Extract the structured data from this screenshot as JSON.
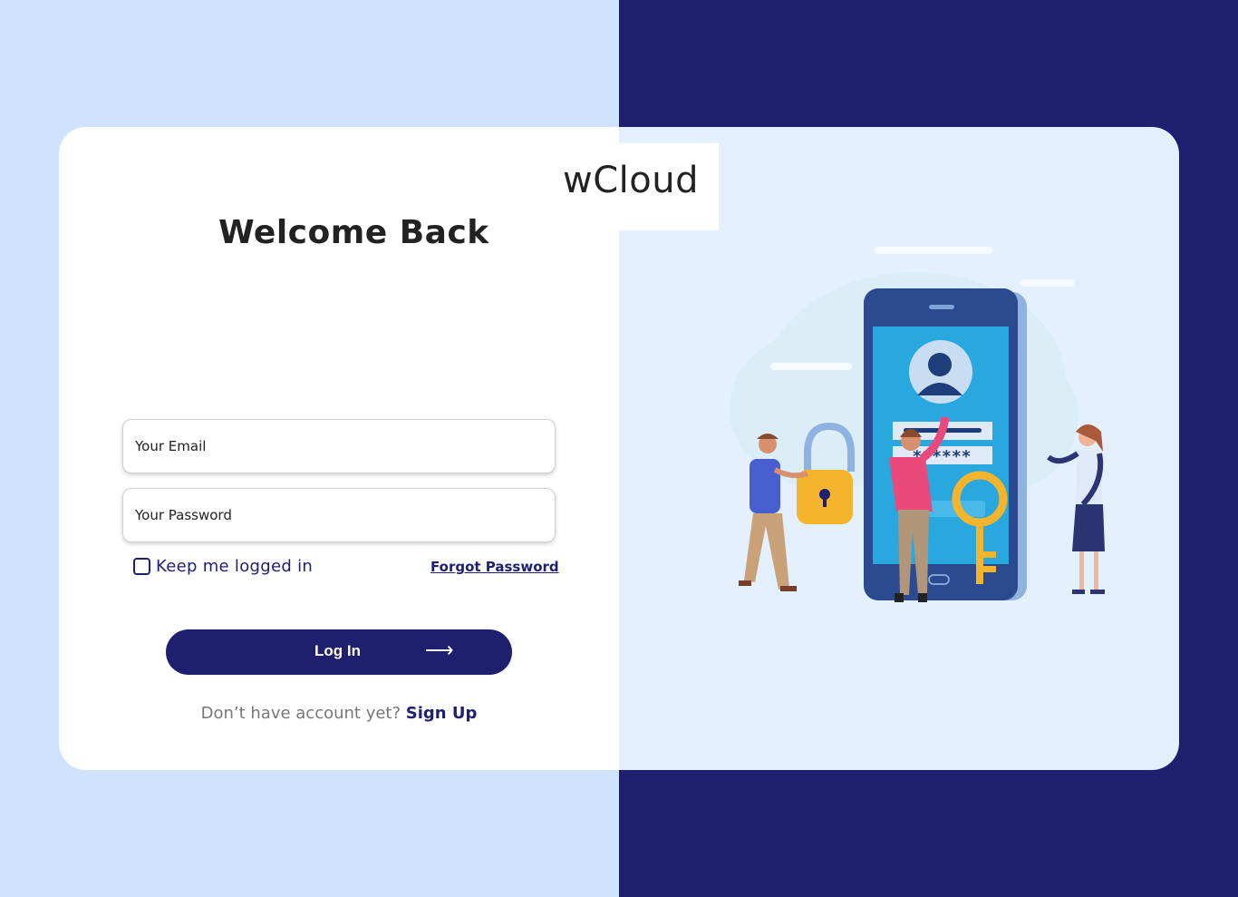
{
  "brand": {
    "name": "wCloud"
  },
  "heading": {
    "welcome": "Welcome Back"
  },
  "form": {
    "email_placeholder": "Your Email",
    "email_value": "",
    "password_placeholder": "Your Password",
    "password_value": "",
    "remember_label": "Keep me logged in",
    "remember_checked": false,
    "forgot_label": "Forgot Password",
    "login_label": "Log In",
    "login_icon": "arrow-right-icon",
    "login_arrow": "⟶"
  },
  "signup": {
    "prompt": "Don’t have account yet?",
    "link": "Sign Up"
  },
  "illustration": {
    "masked_password": "******",
    "icons": [
      "phone-icon",
      "user-avatar-icon",
      "padlock-icon",
      "key-icon"
    ]
  },
  "colors": {
    "navy": "#1f1f70",
    "light_blue": "#cfe3fd",
    "panel_blue": "#e4f0fd",
    "phone_screen": "#29a8e0",
    "accent_yellow": "#f4b52c",
    "accent_pink": "#e9497b"
  }
}
